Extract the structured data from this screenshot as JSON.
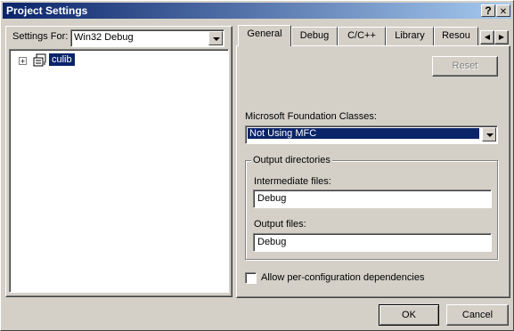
{
  "window": {
    "title": "Project Settings",
    "help_glyph": "?",
    "close_glyph": "✕"
  },
  "settings_for": {
    "label": "Settings For:",
    "value": "Win32 Debug"
  },
  "tree": {
    "expander": "+",
    "project_name": "culib"
  },
  "tabs": [
    "General",
    "Debug",
    "C/C++",
    "Library",
    "Resou"
  ],
  "tab_scroll": {
    "left": "◀",
    "right": "▶"
  },
  "general": {
    "reset_label": "Reset",
    "mfc_label": "Microsoft Foundation Classes:",
    "mfc_value": "Not Using MFC",
    "output_group_label": "Output directories",
    "intermediate_label": "Intermediate files:",
    "intermediate_value": "Debug",
    "output_label": "Output files:",
    "output_value": "Debug",
    "per_config_label": "Allow per-configuration dependencies"
  },
  "footer": {
    "ok_label": "OK",
    "cancel_label": "Cancel"
  },
  "colors": {
    "title_start": "#0a246a",
    "title_end": "#a6caf0",
    "face": "#d4d0c8",
    "selection": "#0a246a"
  }
}
